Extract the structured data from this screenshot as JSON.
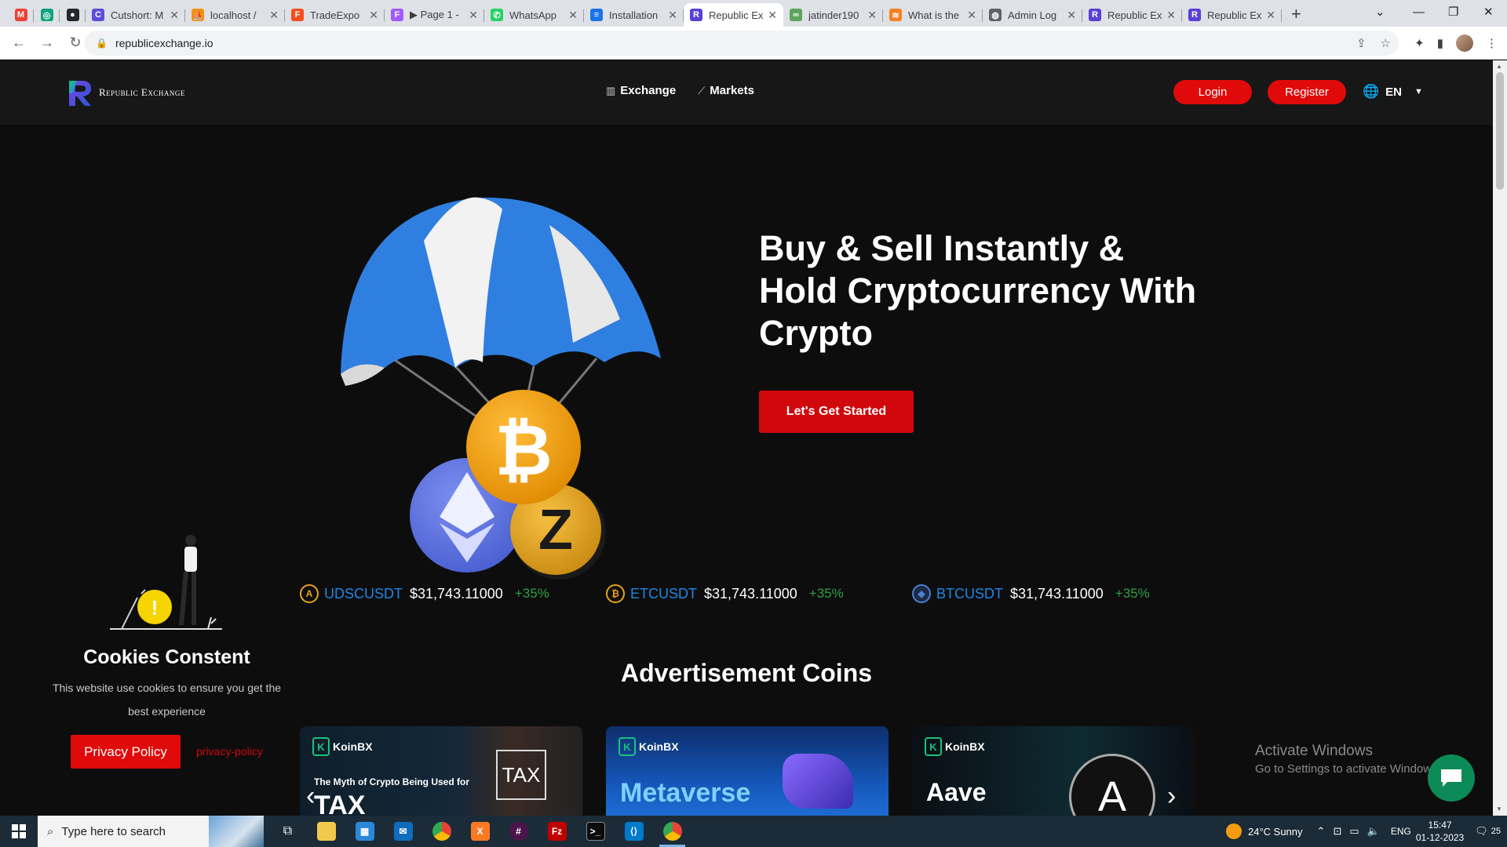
{
  "browser": {
    "tabs": [
      {
        "label": "",
        "icon": "gmail-icon",
        "color": "#ea4335",
        "glyph": "M",
        "pinned": true
      },
      {
        "label": "",
        "icon": "chatgpt-icon",
        "color": "#10a37f",
        "glyph": "◎",
        "pinned": true
      },
      {
        "label": "",
        "icon": "github-icon",
        "color": "#24292f",
        "glyph": "●",
        "pinned": true
      },
      {
        "label": "Cutshort: M",
        "icon": "cutshort-icon",
        "color": "#5b4cdb",
        "glyph": "C"
      },
      {
        "label": "localhost /",
        "icon": "phpmyadmin-icon",
        "color": "#f29111",
        "glyph": "⛵"
      },
      {
        "label": "TradeExpo",
        "icon": "figma-icon",
        "color": "#f24e1e",
        "glyph": "F"
      },
      {
        "label": "▶ Page 1 -",
        "icon": "figma-icon",
        "color": "#a259ff",
        "glyph": "F"
      },
      {
        "label": "WhatsApp",
        "icon": "whatsapp-icon",
        "color": "#25d366",
        "glyph": "✆"
      },
      {
        "label": "Installation",
        "icon": "docs-icon",
        "color": "#1a73e8",
        "glyph": "≡"
      },
      {
        "label": "Republic Ex",
        "icon": "republic-icon",
        "color": "#5a3fd6",
        "glyph": "R",
        "active": true
      },
      {
        "label": "jatinder190",
        "icon": "gitlab-icon",
        "color": "#5fa35a",
        "glyph": "∞"
      },
      {
        "label": "What is the",
        "icon": "stackoverflow-icon",
        "color": "#f48024",
        "glyph": "≋"
      },
      {
        "label": "Admin Log",
        "icon": "globe-icon",
        "color": "#5f6368",
        "glyph": "◍"
      },
      {
        "label": "Republic Ex",
        "icon": "republic-icon",
        "color": "#5a3fd6",
        "glyph": "R"
      },
      {
        "label": "Republic Ex",
        "icon": "republic-icon",
        "color": "#5a3fd6",
        "glyph": "R"
      }
    ],
    "url": "republicexchange.io"
  },
  "site": {
    "logo_text": "Republic Exchange",
    "nav": [
      {
        "label": "Exchange",
        "icon": "bar-chart-icon"
      },
      {
        "label": "Markets",
        "icon": "line-chart-icon"
      }
    ],
    "login": "Login",
    "register": "Register",
    "language": "EN",
    "hero": {
      "title": "Buy & Sell Instantly & Hold Cryptocurrency With Crypto",
      "cta": "Let's Get Started"
    },
    "tickers": [
      {
        "symbol": "UDSCUSDT",
        "price": "$31,743.11000",
        "change": "+35%",
        "icon": "usdc-coin-icon",
        "glyph": "A",
        "color": "#e8a21d"
      },
      {
        "symbol": "ETCUSDT",
        "price": "$31,743.11000",
        "change": "+35%",
        "icon": "bitcoin-coin-icon",
        "glyph": "₿",
        "color": "#e8a21d"
      },
      {
        "symbol": "BTCUSDT",
        "price": "$31,743.11000",
        "change": "+35%",
        "icon": "ethereum-coin-icon",
        "glyph": "◆",
        "color": "#4a7fd4"
      }
    ],
    "ads_title": "Advertisement Coins",
    "ads": [
      {
        "brand": "KoinBX",
        "sub": "The Myth of Crypto Being Used for",
        "head": "TAX",
        "badge": "TAX"
      },
      {
        "brand": "KoinBX",
        "sub": "",
        "head": "Metaverse",
        "badge": ""
      },
      {
        "brand": "KoinBX",
        "sub": "",
        "head": "Aave",
        "badge": ""
      }
    ],
    "cookies": {
      "title": "Cookies Constent",
      "text": "This website use cookies to ensure you get the best experience",
      "button": "Privacy Policy",
      "link": "privacy-policy"
    },
    "watermark": {
      "line1": "Activate Windows",
      "line2": "Go to Settings to activate Windows."
    }
  },
  "taskbar": {
    "search_placeholder": "Type here to search",
    "weather": "24°C  Sunny",
    "lang": "ENG",
    "time": "15:47",
    "date": "01-12-2023",
    "notifications": "25"
  },
  "colors": {
    "accent_red": "#e00a0a",
    "link_blue": "#1e88e5",
    "positive_green": "#2ea043",
    "bg_dark": "#0d0d0d"
  }
}
